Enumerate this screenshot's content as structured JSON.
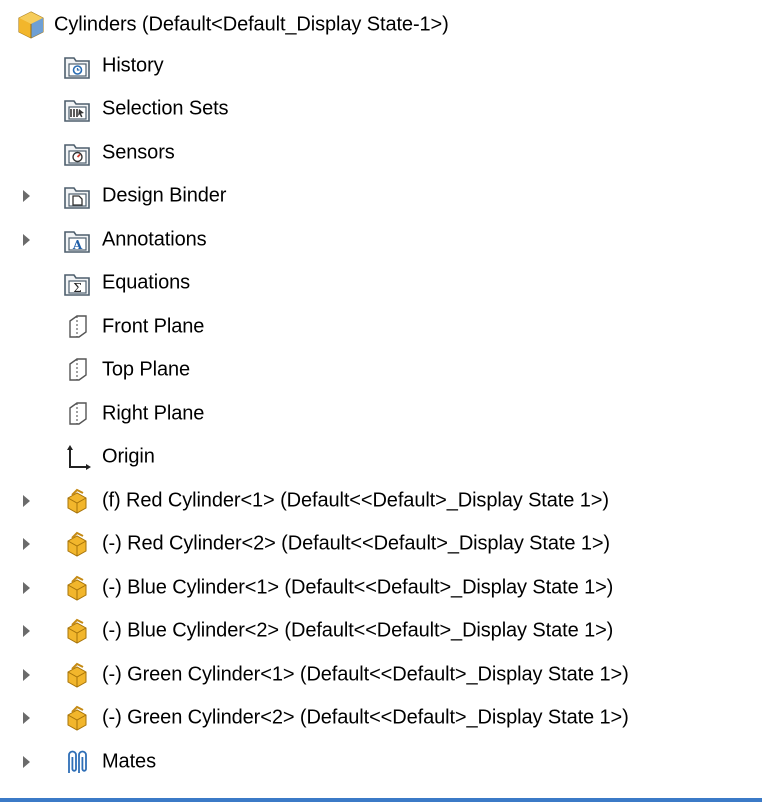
{
  "tree": {
    "root": {
      "label": "Cylinders  (Default<Default_Display State-1>)",
      "icon": "assembly-icon"
    },
    "items": [
      {
        "label": "History",
        "icon": "history-folder-icon",
        "expandable": false
      },
      {
        "label": "Selection Sets",
        "icon": "selection-sets-folder-icon",
        "expandable": false
      },
      {
        "label": "Sensors",
        "icon": "sensors-folder-icon",
        "expandable": false
      },
      {
        "label": "Design Binder",
        "icon": "design-binder-folder-icon",
        "expandable": true
      },
      {
        "label": "Annotations",
        "icon": "annotations-folder-icon",
        "expandable": true
      },
      {
        "label": "Equations",
        "icon": "equations-folder-icon",
        "expandable": false
      },
      {
        "label": "Front Plane",
        "icon": "plane-icon",
        "expandable": false
      },
      {
        "label": "Top Plane",
        "icon": "plane-icon",
        "expandable": false
      },
      {
        "label": "Right Plane",
        "icon": "plane-icon",
        "expandable": false
      },
      {
        "label": "Origin",
        "icon": "origin-icon",
        "expandable": false
      },
      {
        "label": "(f) Red Cylinder<1> (Default<<Default>_Display State 1>)",
        "icon": "part-icon",
        "expandable": true
      },
      {
        "label": "(-) Red Cylinder<2> (Default<<Default>_Display State 1>)",
        "icon": "part-icon",
        "expandable": true
      },
      {
        "label": "(-) Blue Cylinder<1> (Default<<Default>_Display State 1>)",
        "icon": "part-icon",
        "expandable": true
      },
      {
        "label": "(-) Blue Cylinder<2> (Default<<Default>_Display State 1>)",
        "icon": "part-icon",
        "expandable": true
      },
      {
        "label": "(-) Green Cylinder<1> (Default<<Default>_Display State 1>)",
        "icon": "part-icon",
        "expandable": true
      },
      {
        "label": "(-) Green Cylinder<2> (Default<<Default>_Display State 1>)",
        "icon": "part-icon",
        "expandable": true
      },
      {
        "label": "Mates",
        "icon": "mates-icon",
        "expandable": true
      }
    ]
  },
  "colors": {
    "accent": "#3b7ac7",
    "part_yellow": "#f2b62c",
    "folder_gray": "#5c6f7e"
  }
}
